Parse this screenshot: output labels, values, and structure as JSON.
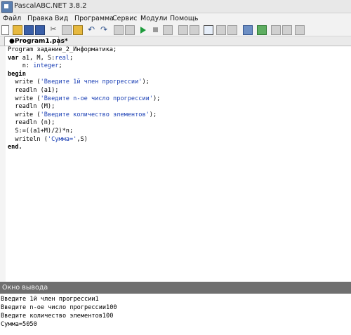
{
  "window": {
    "title": "PascalABC.NET 3.8.2"
  },
  "menu": [
    "Файл",
    "Правка",
    "Вид",
    "Программа",
    "Сервис",
    "Модули",
    "Помощь"
  ],
  "toolbar": {
    "icons": [
      "new-file-icon",
      "open-folder-icon",
      "save-icon",
      "save-all-icon",
      "cut-icon",
      "copy-icon",
      "paste-icon",
      "undo-icon",
      "redo-icon",
      "compile-icon",
      "run-icon",
      "stop-icon",
      "debug-icon",
      "step-icon",
      "format-icon",
      "layout-icon",
      "layout-alt-icon",
      "settings-icon",
      "module-icon",
      "window-icon",
      "window-alt-icon",
      "help-icon"
    ]
  },
  "tab": {
    "label": "●Program1.pas*"
  },
  "code": {
    "l1": "Program задание_2_Информатика;",
    "l2_kw": "var",
    "l2_rest": " a1, M, S:",
    "l2_type": "real",
    "l2_end": ";",
    "l3_rest": "    n: ",
    "l3_type": "integer",
    "l3_end": ";",
    "l4": "begin",
    "l5_a": "  write (",
    "l5_s": "'Введите 1й член прогрессии'",
    "l5_b": ");",
    "l6": "  readln (a1);",
    "l7_a": "  write (",
    "l7_s": "'Введите n-ое число прогрессии'",
    "l7_b": ");",
    "l8": "  readln (M);",
    "l9_a": "  write (",
    "l9_s": "'Введите количество элементов'",
    "l9_b": ");",
    "l10": "  readln (n);",
    "l11": "  S:=((a1+M)/2)*n;",
    "l12_a": "  writeln (",
    "l12_s": "'Сумма='",
    "l12_b": ",S)",
    "l13": "end."
  },
  "output": {
    "title": "Окно вывода",
    "lines": [
      "Введите 1й член прогрессии1",
      "Введите n-ое число прогрессии100",
      "Введите количество элементов100",
      "Сумма=5050"
    ]
  }
}
